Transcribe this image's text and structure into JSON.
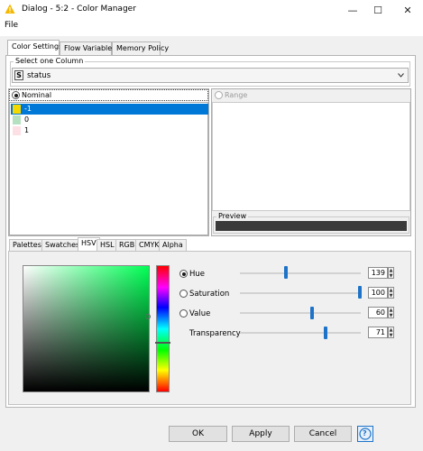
{
  "window": {
    "title": "Dialog - 5:2 - Color Manager",
    "controls": {
      "minimize": "—",
      "maximize": "☐",
      "close": "✕"
    }
  },
  "menu": {
    "file": "File"
  },
  "tabs": [
    "Color Settings",
    "Flow Variables",
    "Memory Policy"
  ],
  "column_group": {
    "legend": "Select one Column",
    "type_badge": "S",
    "selected": "status"
  },
  "nominal": {
    "label": "Nominal",
    "items": [
      {
        "label": "-1",
        "color": "#f5d800"
      },
      {
        "label": "0",
        "color": "#b5e1c0"
      },
      {
        "label": "1",
        "color": "#fddfe6"
      }
    ]
  },
  "range": {
    "label": "Range"
  },
  "preview": {
    "legend": "Preview",
    "color": "#3a3a3a"
  },
  "picker_tabs": [
    "Palettes",
    "Swatches",
    "HSV",
    "HSL",
    "RGB",
    "CMYK",
    "Alpha"
  ],
  "hsv": {
    "hue": {
      "label": "Hue",
      "value": "139",
      "fraction": 0.386
    },
    "saturation": {
      "label": "Saturation",
      "value": "100",
      "fraction": 1.0
    },
    "value": {
      "label": "Value",
      "value": "60",
      "fraction": 0.6
    },
    "transparency": {
      "label": "Transparency",
      "value": "71",
      "fraction": 0.71
    }
  },
  "buttons": {
    "ok": "OK",
    "apply": "Apply",
    "cancel": "Cancel",
    "help": "?"
  },
  "colors": {
    "accent": "#0078d7",
    "selection": "#0078d7",
    "thumb": "#1e73c8"
  }
}
